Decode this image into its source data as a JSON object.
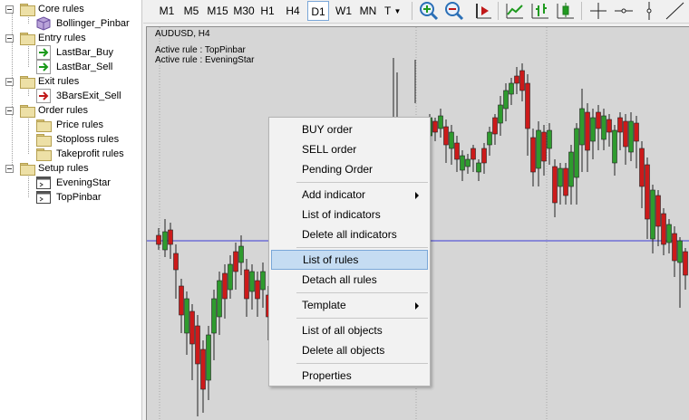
{
  "tree": {
    "items": [
      {
        "label": "Core rules",
        "kind": "folder",
        "icon": "folder-icon",
        "level": 0
      },
      {
        "label": "Bollinger_Pinbar",
        "kind": "leaf",
        "icon": "cube-icon",
        "level": 1
      },
      {
        "label": "Entry rules",
        "kind": "folder",
        "icon": "folder-icon",
        "level": 0
      },
      {
        "label": "LastBar_Buy",
        "kind": "leaf",
        "icon": "green-arrow-icon",
        "level": 1
      },
      {
        "label": "LastBar_Sell",
        "kind": "leaf",
        "icon": "green-arrow-icon",
        "level": 1
      },
      {
        "label": "Exit rules",
        "kind": "folder",
        "icon": "folder-icon",
        "level": 0
      },
      {
        "label": "3BarsExit_Sell",
        "kind": "leaf",
        "icon": "red-arrow-icon",
        "level": 1
      },
      {
        "label": "Order rules",
        "kind": "folder",
        "icon": "folder-icon",
        "level": 0
      },
      {
        "label": "Price rules",
        "kind": "folder",
        "icon": "folder-icon",
        "level": 1
      },
      {
        "label": "Stoploss rules",
        "kind": "folder",
        "icon": "folder-icon",
        "level": 1
      },
      {
        "label": "Takeprofit rules",
        "kind": "folder",
        "icon": "folder-icon",
        "level": 1
      },
      {
        "label": "Setup rules",
        "kind": "folder",
        "icon": "folder-icon",
        "level": 0
      },
      {
        "label": "EveningStar",
        "kind": "leaf",
        "icon": "window-icon",
        "level": 1
      },
      {
        "label": "TopPinbar",
        "kind": "leaf",
        "icon": "window-icon",
        "level": 1
      }
    ]
  },
  "toolbar": {
    "timeframes": [
      "M1",
      "M5",
      "M15",
      "M30",
      "H1",
      "H4",
      "D1",
      "W1",
      "MN",
      "T"
    ],
    "active_timeframe": "D1",
    "icons": [
      "zoom-in-icon",
      "zoom-out-icon",
      "chart-shift-icon",
      "line-chart-icon",
      "bar-chart-icon",
      "candlestick-icon",
      "crosshair-icon",
      "horizontal-line-icon",
      "vertical-line-icon",
      "trendline-icon"
    ]
  },
  "chart": {
    "symbol_title": "AUDUSD, H4",
    "active_rules": [
      "Active rule : TopPinbar",
      "Active rule : EveningStar"
    ],
    "colors": {
      "background": "#d6d6d6",
      "bull": "#2e9b2e",
      "bear": "#cc1a1a",
      "level_line": "#3b3bd6"
    }
  },
  "menu": {
    "items": [
      {
        "label": "BUY order",
        "submenu": false,
        "highlighted": false
      },
      {
        "label": "SELL order",
        "submenu": false,
        "highlighted": false
      },
      {
        "label": "Pending Order",
        "submenu": false,
        "highlighted": false
      },
      {
        "label": "Add indicator",
        "submenu": true,
        "highlighted": false
      },
      {
        "label": "List of indicators",
        "submenu": false,
        "highlighted": false
      },
      {
        "label": "Delete all indicators",
        "submenu": false,
        "highlighted": false
      },
      {
        "label": "List of rules",
        "submenu": false,
        "highlighted": true
      },
      {
        "label": "Detach all rules",
        "submenu": false,
        "highlighted": false
      },
      {
        "label": "Template",
        "submenu": true,
        "highlighted": false
      },
      {
        "label": "List of all objects",
        "submenu": false,
        "highlighted": false
      },
      {
        "label": "Delete all objects",
        "submenu": false,
        "highlighted": false
      },
      {
        "label": "Properties",
        "submenu": false,
        "highlighted": false
      }
    ]
  }
}
